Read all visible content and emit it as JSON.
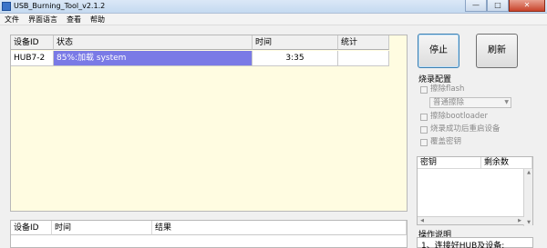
{
  "window": {
    "title": "USB_Burning_Tool_v2.1.2",
    "minimize_glyph": "—",
    "maximize_glyph": "□",
    "close_glyph": "✕"
  },
  "menu": [
    "文件",
    "界面语言",
    "查看",
    "帮助"
  ],
  "device_table": {
    "columns": [
      "设备ID",
      "状态",
      "时间",
      "统计"
    ],
    "rows": [
      {
        "id": "HUB7-2",
        "status": "85%:加载 system",
        "progress": 0.85,
        "time": "3:35",
        "count": ""
      }
    ]
  },
  "log_table": {
    "columns": [
      "设备ID",
      "时间",
      "结果"
    ]
  },
  "buttons": {
    "stop": "停止",
    "refresh": "刷新"
  },
  "burn_config": {
    "title": "烧录配置",
    "erase_flash": "擦除flash",
    "erase_mode": "普通擦除",
    "erase_bootloader": "擦除bootloader",
    "reboot_after": "烧录成功后重启设备",
    "overwrite_key": "覆盖密钥"
  },
  "key_list": {
    "columns": [
      "密钥",
      "剩余数"
    ]
  },
  "instructions": {
    "title": "操作说明",
    "step1": "1、连接好HUB及设备;"
  },
  "colors": {
    "device_area_bg": "#fffce1",
    "progress_fill": "#7a7ae6"
  }
}
